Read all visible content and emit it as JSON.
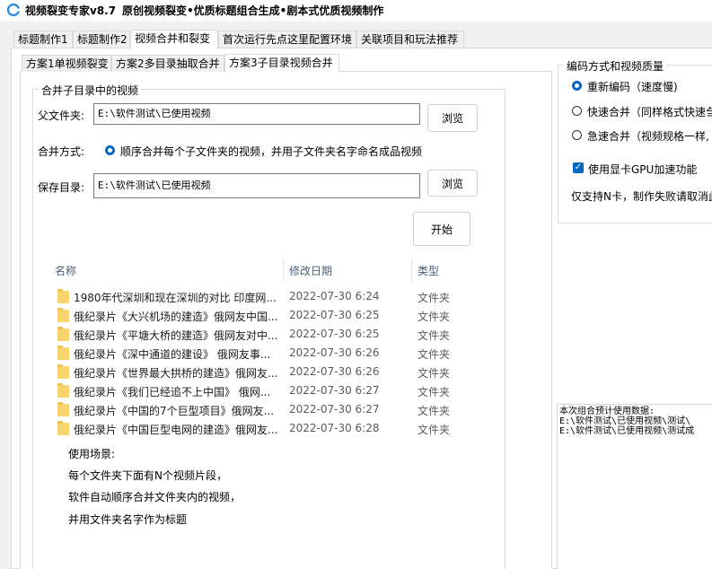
{
  "window": {
    "title": "视频裂变专家v8.7",
    "subtitle": "原创视频裂变•优质标题组合生成•剧本式优质视频制作"
  },
  "main_tabs": [
    {
      "label": "标题制作1"
    },
    {
      "label": "标题制作2"
    },
    {
      "label": "视频合并和裂变"
    },
    {
      "label": "首次运行先点这里配置环境"
    },
    {
      "label": "关联项目和玩法推荐"
    }
  ],
  "sub_tabs": [
    {
      "label": "方案1单视频裂变"
    },
    {
      "label": "方案2多目录抽取合并"
    },
    {
      "label": "方案3子目录视频合并"
    }
  ],
  "merge_group": {
    "title": "合并子目录中的视频",
    "parent_label": "父文件夹:",
    "parent_value": "E:\\软件测试\\已使用视频",
    "browse1": "浏览",
    "mode_label": "合并方式:",
    "mode_option": "顺序合并每个子文件夹的视频，并用子文件夹名字命名成品视频",
    "save_label": "保存目录:",
    "save_value": "E:\\软件测试\\已使用视频",
    "browse2": "浏览",
    "start": "开始"
  },
  "file_list": {
    "columns": {
      "name": "名称",
      "date": "修改日期",
      "type": "类型"
    },
    "rows": [
      {
        "name": "1980年代深圳和现在深圳的对比 印度网...",
        "date": "2022-07-30 6:24",
        "type": "文件夹"
      },
      {
        "name": "俄纪录片《大兴机场的建造》俄网友中国...",
        "date": "2022-07-30 6:25",
        "type": "文件夹"
      },
      {
        "name": "俄纪录片《平塘大桥的建造》俄网友对中...",
        "date": "2022-07-30 6:25",
        "type": "文件夹"
      },
      {
        "name": "俄纪录片《深中通道的建设》 俄网友事...",
        "date": "2022-07-30 6:26",
        "type": "文件夹"
      },
      {
        "name": "俄纪录片《世界最大拱桥的建造》俄网友...",
        "date": "2022-07-30 6:26",
        "type": "文件夹"
      },
      {
        "name": "俄纪录片《我们已经追不上中国》 俄网...",
        "date": "2022-07-30 6:27",
        "type": "文件夹"
      },
      {
        "name": "俄纪录片《中国的7个巨型项目》俄网友...",
        "date": "2022-07-30 6:27",
        "type": "文件夹"
      },
      {
        "name": "俄纪录片《中国巨型电网的建造》俄网友...",
        "date": "2022-07-30 6:28",
        "type": "文件夹"
      }
    ]
  },
  "usage_notes": [
    "使用场景:",
    "每个文件夹下面有N个视频片段，",
    "软件自动顺序合并文件夹内的视频，",
    "并用文件夹名字作为标题"
  ],
  "encoding": {
    "title": "编码方式和视频质量",
    "options": [
      {
        "label": "重新编码（速度慢)",
        "selected": true
      },
      {
        "label": "快速合并（同样格式快速刍",
        "selected": false
      },
      {
        "label": "急速合并（视频规格一样,",
        "selected": false
      }
    ],
    "gpu_label": "使用显卡GPU加速功能",
    "gpu_checked": true,
    "note": "仅支持N卡，制作失败请取消此"
  },
  "log": {
    "lines": [
      "本次组合预计使用数据:",
      "E:\\软件测试\\已使用视频\\测试\\",
      "E:\\软件测试\\已使用视频\\测试成"
    ]
  },
  "colors": {
    "accent": "#0067c0",
    "folder": "#f7d46d"
  }
}
